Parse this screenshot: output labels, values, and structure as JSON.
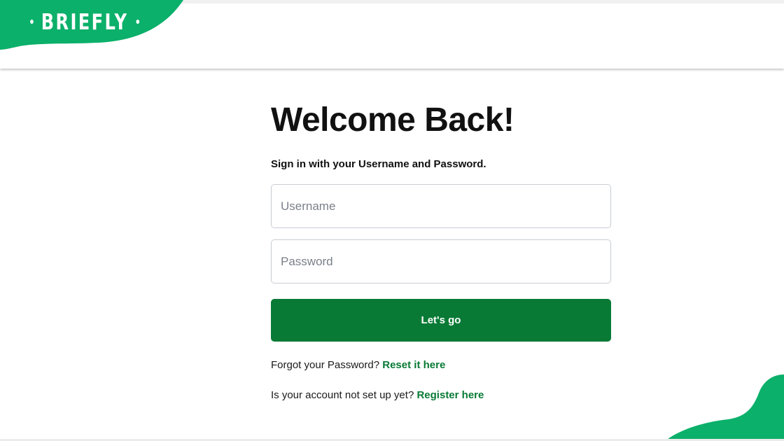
{
  "brand": {
    "name": "BRIEFLY",
    "accent_color": "#0bb06a",
    "button_color": "#087a35"
  },
  "login": {
    "title": "Welcome Back!",
    "subtitle": "Sign in with your Username and Password.",
    "username_placeholder": "Username",
    "password_placeholder": "Password",
    "submit_label": "Let's go",
    "forgot_text": "Forgot your Password?",
    "forgot_link": "Reset it here",
    "register_text": "Is your account not set up yet?",
    "register_link": "Register here"
  }
}
